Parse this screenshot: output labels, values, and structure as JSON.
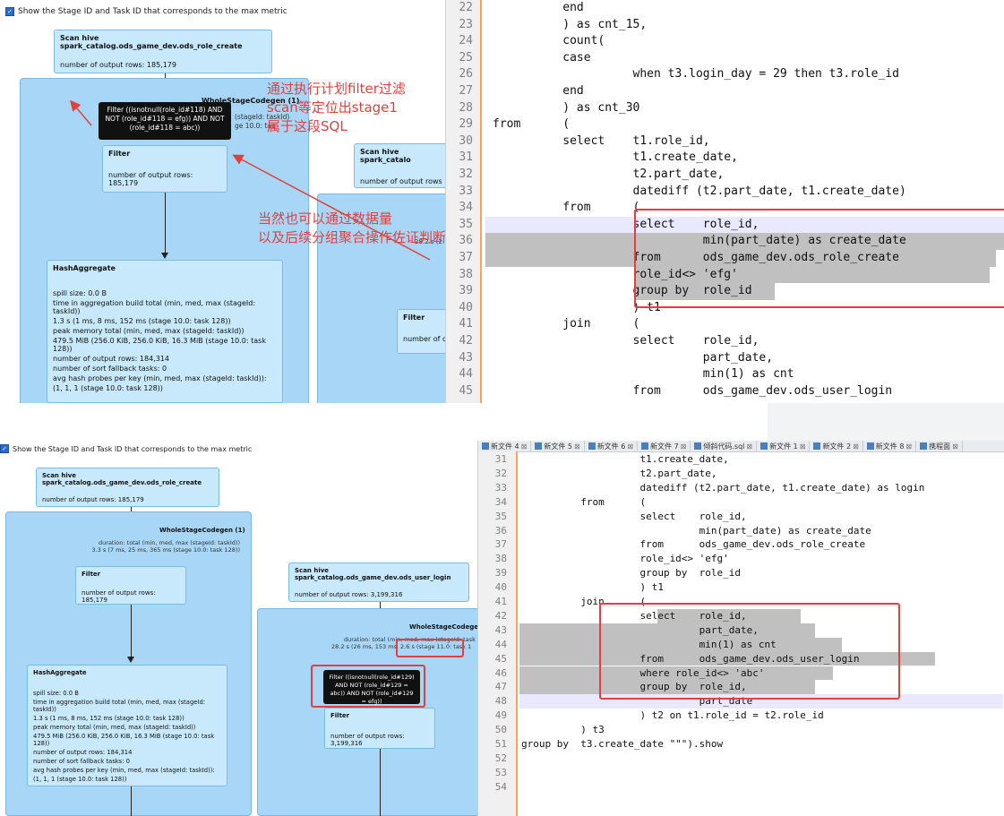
{
  "top": {
    "checkbox_label": "Show the Stage ID and Task ID that corresponds to the max metric",
    "scan_role_create": {
      "title": "Scan hive spark_catalog.ods_game_dev.ods_role_create",
      "rows": "number of output rows: 185,179"
    },
    "wsc_title": "WholeStageCodegen (1)",
    "wsc_duration_partial": "(stageId: taskId)",
    "wsc_duration2_partial": "ge 10.0: tas",
    "tooltip": "Filter ((isnotnull(role_id#118) AND NOT (role_id#118 = efg)) AND NOT (role_id#118 = abc))",
    "filter": {
      "title": "Filter",
      "rows": "number of output rows: 185,179"
    },
    "hashagg": {
      "title": "HashAggregate",
      "lines": [
        "spill size: 0.0 B",
        "time in aggregation build total (min, med, max (stageId: taskId))",
        "1.3 s (1 ms, 8 ms, 152 ms (stage 10.0: task 128))",
        "peak memory total (min, med, max (stageId: taskId))",
        "479.5 MiB (256.0 KiB, 256.0 KiB, 16.3 MiB (stage 10.0: task 128))",
        "number of output rows: 184,314",
        "number of sort fallback tasks: 0",
        "avg hash probes per key (min, med, max (stageId: taskId)):",
        "(1, 1, 1 (stage 10.0: task 128))"
      ]
    },
    "scan_right": {
      "title": "Scan hive spark_catalo",
      "rows": "number of output rows"
    },
    "right_cluster_partial": "28.2 s (2",
    "filter_right": {
      "title": "Filter",
      "rows": "number of o"
    },
    "annotation1": [
      "通过执行计划filter过滤",
      "scan等定位出stage1",
      "属于这段SQL"
    ],
    "annotation2": [
      "当然也可以通过数据量",
      "以及后续分组聚合操作佐证判断"
    ],
    "code_lines": [
      {
        "n": "22",
        "t": "          end"
      },
      {
        "n": "23",
        "t": "          ) as cnt_15,"
      },
      {
        "n": "24",
        "t": "          count("
      },
      {
        "n": "25",
        "t": "          case"
      },
      {
        "n": "26",
        "t": "                    when t3.login_day = 29 then t3.role_id"
      },
      {
        "n": "27",
        "t": "          end"
      },
      {
        "n": "28",
        "t": "          ) as cnt_30"
      },
      {
        "n": "29",
        "t": "from      ("
      },
      {
        "n": "30",
        "t": "          select    t1.role_id,"
      },
      {
        "n": "31",
        "t": "                    t1.create_date,"
      },
      {
        "n": "32",
        "t": "                    t2.part_date,"
      },
      {
        "n": "33",
        "t": "                    datediff (t2.part_date, t1.create_date)"
      },
      {
        "n": "34",
        "t": "          from      ("
      },
      {
        "n": "35",
        "t": "                    select    role_id,"
      },
      {
        "n": "36",
        "t": "                              min(part_date) as create_date"
      },
      {
        "n": "37",
        "t": "                    from      ods_game_dev.ods_role_create"
      },
      {
        "n": "38",
        "t": "                    role_id<> 'efg'"
      },
      {
        "n": "39",
        "t": "                    group by  role_id"
      },
      {
        "n": "40",
        "t": "                    ) t1"
      },
      {
        "n": "41",
        "t": "          join      ("
      },
      {
        "n": "42",
        "t": "                    select    role_id,"
      },
      {
        "n": "43",
        "t": "                              part_date,"
      },
      {
        "n": "44",
        "t": "                              min(1) as cnt"
      },
      {
        "n": "45",
        "t": "                    from      ods_game_dev.ods_user_login"
      }
    ]
  },
  "bottom": {
    "checkbox_label": "Show the Stage ID and Task ID that corresponds to the max metric",
    "scan_role_create": {
      "title": "Scan hive spark_catalog.ods_game_dev.ods_role_create",
      "rows": "number of output rows: 185,179"
    },
    "wsc_title": "WholeStageCodegen (1)",
    "wsc_duration": [
      "duration: total (min, med, max (stageId: taskId))",
      "3.3 s (7 ms, 25 ms, 365 ms (stage 10.0: task 128))"
    ],
    "filter": {
      "title": "Filter",
      "rows": "number of output rows: 185,179"
    },
    "hashagg": {
      "title": "HashAggregate",
      "lines": [
        "spill size: 0.0 B",
        "time in aggregation build total (min, med, max (stageId: taskId))",
        "1.3 s (1 ms, 8 ms, 152 ms (stage 10.0: task 128))",
        "peak memory total (min, med, max (stageId: taskId))",
        "479.5 MiB (256.0 KiB, 256.0 KiB, 16.3 MiB (stage 10.0: task 128))",
        "number of output rows: 184,314",
        "number of sort fallback tasks: 0",
        "avg hash probes per key (min, med, max (stageId: taskId)):",
        "(1, 1, 1 (stage 10.0: task 128))"
      ]
    },
    "scan_user_login": {
      "title": "Scan hive spark_catalog.ods_game_dev.ods_user_login",
      "rows": "number of output rows: 3,199,316"
    },
    "wsc2_title": "WholeStageCodegen",
    "wsc2_duration": [
      "duration: total (min, med, max (stageId: task",
      "28.2 s (26 ms, 153 ms, 2.6 s (stage 11.0: task 1"
    ],
    "tooltip": "Filter ((isnotnull(role_id#129) AND NOT (role_id#129 = abc)) AND NOT (role_id#129 = efg))",
    "filter2": {
      "title": "Filter",
      "rows": "number of output rows: 3,199,316"
    },
    "tabs": [
      "新文件 4",
      "新文件 5",
      "新文件 6",
      "新文件 7",
      "倾斜代码.sql",
      "新文件 1",
      "新文件 2",
      "新文件 8",
      "携程面"
    ],
    "code_lines": [
      {
        "n": "31",
        "t": "                    t1.create_date,"
      },
      {
        "n": "32",
        "t": "                    t2.part_date,"
      },
      {
        "n": "33",
        "t": "                    datediff (t2.part_date, t1.create_date) as login"
      },
      {
        "n": "34",
        "t": "          from      ("
      },
      {
        "n": "35",
        "t": "                    select    role_id,"
      },
      {
        "n": "36",
        "t": "                              min(part_date) as create_date"
      },
      {
        "n": "37",
        "t": "                    from      ods_game_dev.ods_role_create"
      },
      {
        "n": "38",
        "t": "                    role_id<> 'efg'"
      },
      {
        "n": "39",
        "t": "                    group by  role_id"
      },
      {
        "n": "40",
        "t": "                    ) t1"
      },
      {
        "n": "41",
        "t": "          join      ("
      },
      {
        "n": "42",
        "t": "                    select    role_id,"
      },
      {
        "n": "43",
        "t": "                              part_date,"
      },
      {
        "n": "44",
        "t": "                              min(1) as cnt"
      },
      {
        "n": "45",
        "t": "                    from      ods_game_dev.ods_user_login"
      },
      {
        "n": "46",
        "t": "                    where role_id<> 'abc'"
      },
      {
        "n": "47",
        "t": "                    group by  role_id,"
      },
      {
        "n": "48",
        "t": "                              part_date"
      },
      {
        "n": "49",
        "t": "                    ) t2 on t1.role_id = t2.role_id"
      },
      {
        "n": "50",
        "t": "          ) t3"
      },
      {
        "n": "51",
        "t": "group by  t3.create_date \"\"\").show"
      },
      {
        "n": "52",
        "t": ""
      },
      {
        "n": "53",
        "t": ""
      },
      {
        "n": "54",
        "t": ""
      }
    ]
  }
}
